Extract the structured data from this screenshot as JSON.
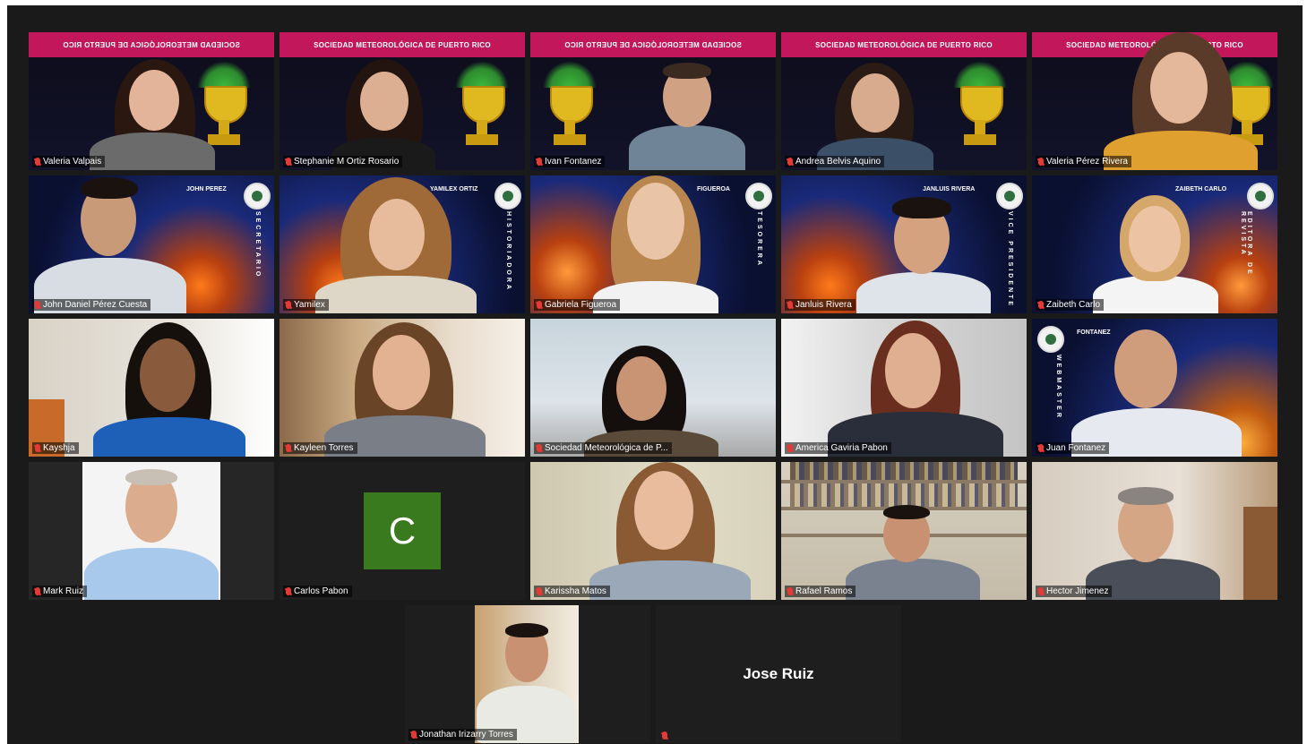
{
  "meeting": {
    "banner_text": "Sociedad Meteorológica de Puerto Rico",
    "banner_text_mirrored": "Sociedad Meteorológica de Puerto Rico",
    "participants": [
      {
        "name": "Valeria Valpais"
      },
      {
        "name": "Stephanie M Ortiz Rosario"
      },
      {
        "name": "Ivan Fontanez"
      },
      {
        "name": "Andrea Belvis Aquino"
      },
      {
        "name": "Valeria Pérez Rivera"
      },
      {
        "name": "John Daniel Pérez Cuesta",
        "role_badge": "JOHN PEREZ",
        "role_vertical": "SECRETARIO"
      },
      {
        "name": "Yamilex",
        "role_badge": "YAMILEX ORTIZ",
        "role_vertical": "HISTORIADORA"
      },
      {
        "name": "Gabriela Figueroa",
        "role_badge": "FIGUEROA",
        "role_vertical": "TESORERA"
      },
      {
        "name": "Janluis Rivera",
        "role_badge": "JANLUIS RIVERA",
        "role_vertical": "VICE PRESIDENTE"
      },
      {
        "name": "Zaibeth Carlo",
        "role_badge": "ZAIBETH CARLO",
        "role_vertical": "EDITORA DE REVISTA"
      },
      {
        "name": "Kayshja"
      },
      {
        "name": "Kayleen Torres"
      },
      {
        "name": "Sociedad Meteorológica de P..."
      },
      {
        "name": "America Gaviria Pabon"
      },
      {
        "name": "Juan Fontanez",
        "role_badge": "FONTANEZ",
        "role_vertical": "WEBMASTER"
      },
      {
        "name": "Mark Ruiz"
      },
      {
        "name": "Carlos Pabon",
        "avatar_initial": "C"
      },
      {
        "name": "Karissha Matos"
      },
      {
        "name": "Rafael Ramos"
      },
      {
        "name": "Hector Jimenez"
      },
      {
        "name": "Jonathan Irizarry Torres"
      },
      {
        "name": "",
        "display_name": "Jose Ruiz"
      }
    ]
  },
  "colors": {
    "banner": "#c2185b",
    "avatar_green": "#3a7a1e",
    "active_speaker": "#c8d23a",
    "mic_muted": "#e53935",
    "background": "#1a1a1a"
  },
  "icons": [
    "microphone-muted-icon",
    "society-logo-icon",
    "trophy-icon"
  ]
}
